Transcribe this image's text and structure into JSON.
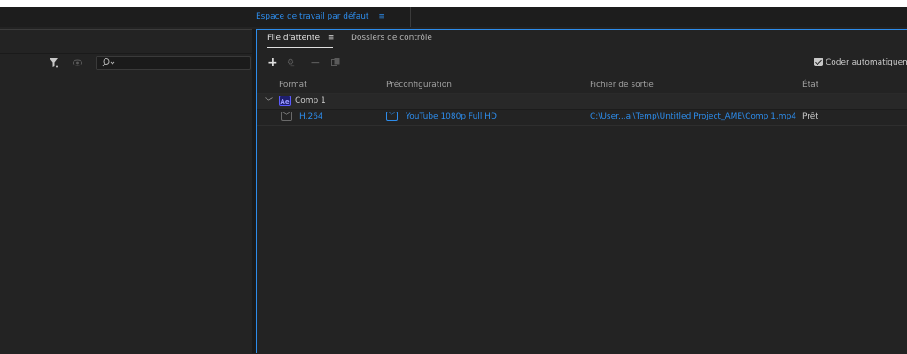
{
  "workspace": {
    "label": "Espace de travail par défaut",
    "menu_icon": "hamburger-icon"
  },
  "left_panel": {
    "filter_icon": "filter-icon",
    "eye_icon": "eye-icon",
    "search_placeholder": ""
  },
  "queue_panel": {
    "tabs": [
      {
        "label": "File d'attente",
        "active": true
      },
      {
        "label": "Dossiers de contrôle",
        "active": false
      }
    ],
    "toolbar": {
      "add": "+",
      "settings": "⚙",
      "remove": "−",
      "auto_encode_label": "Coder automatiquem",
      "auto_encode_checked": true
    },
    "columns": [
      "Format",
      "Préconfiguration",
      "Fichier de sortie",
      "État"
    ],
    "groups": [
      {
        "badge": "Ae",
        "name": "Comp 1",
        "items": [
          {
            "format": "H.264",
            "preset": "YouTube 1080p Full HD",
            "output": "C:\\User...al\\Temp\\Untitled Project_AME\\Comp 1.mp4",
            "status": "Prêt"
          }
        ]
      }
    ]
  },
  "colors": {
    "accent": "#2d8ceb",
    "bg": "#232323",
    "text": "#b4b4b4"
  }
}
